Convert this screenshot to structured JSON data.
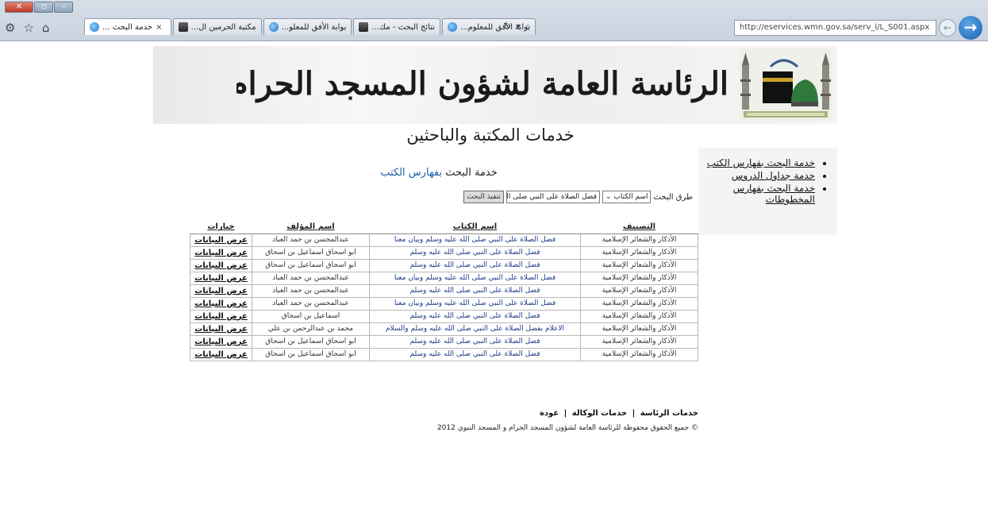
{
  "browser": {
    "address": "http://eservices.wmn.gov.sa/serv_l/L_S001.aspx",
    "address_domain": "wmn.gov.sa",
    "tabs": [
      {
        "label": "خدمة البحث ...",
        "active": true
      },
      {
        "label": "مكتبة الحرمين ال...",
        "active": false
      },
      {
        "label": "بوابة الأفق للمعلو...",
        "active": false
      },
      {
        "label": "نتائج البحث - مك...",
        "active": false
      },
      {
        "label": "بوابة الأفق للمعلوم...",
        "active": false
      }
    ],
    "close_tab_glyph": "×"
  },
  "header": {
    "banner_title": "الرئاسة العامة لشؤون المسجد الحرام والمسجد النبوي",
    "subtitle": "خدمات المكتبة والباحثين"
  },
  "sidebar": {
    "items": [
      {
        "label": "خدمة البحث بفهارس الكتب"
      },
      {
        "label": "خدمة جداول الدروس"
      },
      {
        "label": "خدمة البحث بفهارس المخطوطات"
      }
    ]
  },
  "service": {
    "title_prefix": "خدمة البحث",
    "title_highlight": "بفهارس الكتب"
  },
  "search": {
    "label": "طرق البحث",
    "method_value": "اسم الكتاب",
    "query_value": "فضل الصلاة على النبي صلى الله عليه",
    "submit_label": "تنفيذ البحث"
  },
  "table": {
    "headers": [
      "التصنيف",
      "اسم الكتاب",
      "اسم المؤلف",
      "خيارات"
    ],
    "rows": [
      [
        "الأذكار والشعائر الإسلامية",
        "فضل الصلاة على النبي صلى الله عليه وسلم وبيان معنا",
        "عبدالمحسن بن حمد العباد",
        "عرض البيانات"
      ],
      [
        "الأذكار والشعائر الإسلامية",
        "فضل الصلاة على النبي صلى الله عليه وسلم",
        "ابو اسحاق اسماعيل بن اسحاق",
        "عرض البيانات"
      ],
      [
        "الأذكار والشعائر الإسلامية",
        "فضل الصلاة على النبي صلى الله عليه وسلم",
        "ابو اسحاق اسماعيل بن اسحاق",
        "عرض البيانات"
      ],
      [
        "الأذكار والشعائر الإسلامية",
        "فضل الصلاة على النبي صلى الله عليه وسلم وبيان معنا",
        "عبدالمحسن بن حمد العباد",
        "عرض البيانات"
      ],
      [
        "الأذكار والشعائر الإسلامية",
        "فضل الصلاة على النبي صلى الله عليه وسلم",
        "عبدالمحسن بن حمد العباد",
        "عرض البيانات"
      ],
      [
        "الأذكار والشعائر الإسلامية",
        "فضل الصلاة على النبي صلى الله عليه وسلم وبيان معنا",
        "عبدالمحسن بن حمد العباد",
        "عرض البيانات"
      ],
      [
        "الأذكار والشعائر الإسلامية",
        "فضل الصلاة على النبي صلى الله عليه وسلم",
        "اسماعيل بن اسحاق",
        "عرض البيانات"
      ],
      [
        "الأذكار والشعائر الإسلامية",
        "الاعلام بفضل الصلاة على النبي صلى الله عليه وسلم والسلام",
        "محمد بن عبدالرحمن بن علي",
        "عرض البيانات"
      ],
      [
        "الأذكار والشعائر الإسلامية",
        "فضل الصلاة على النبي صلى الله عليه وسلم",
        "ابو اسحاق اسماعيل بن اسحاق",
        "عرض البيانات"
      ],
      [
        "الأذكار والشعائر الإسلامية",
        "فضل الصلاة على النبي صلى الله عليه وسلم",
        "ابو اسحاق اسماعيل بن اسحاق",
        "عرض البيانات"
      ]
    ]
  },
  "footer": {
    "links": [
      "خدمات الرئاسة",
      "خدمات الوكالة",
      "عودة"
    ],
    "separator": "|",
    "copyright": "© جميع الحقوق محفوظة للرئاسة العامة لشؤون المسجد الحرام و المسجد النبوي 2012"
  }
}
